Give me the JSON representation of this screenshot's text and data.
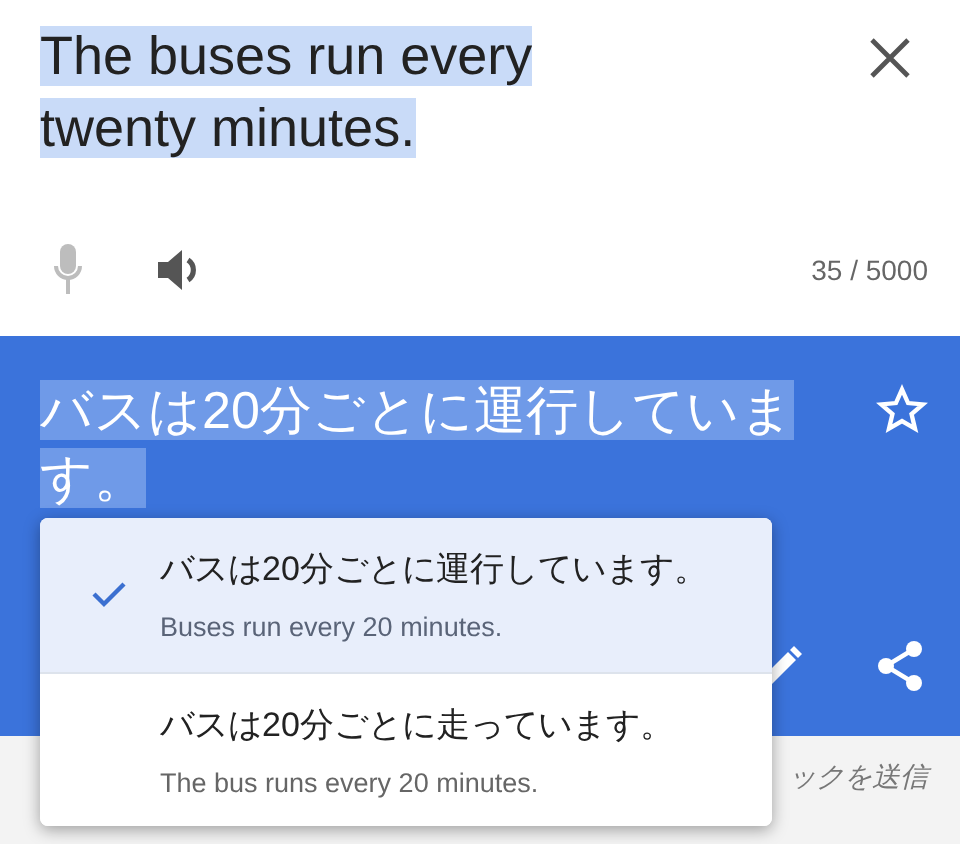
{
  "source": {
    "text": "The buses run every twenty minutes.",
    "selected": true,
    "count": "35 / 5000",
    "mic_disabled": true
  },
  "translation": {
    "text": "バスは20分ごとに運行しています。",
    "selected": true
  },
  "feedback": "ックを送信",
  "alternatives": [
    {
      "text": "バスは20分ごとに運行しています。",
      "meaning": "Buses run every 20 minutes.",
      "selected": true
    },
    {
      "text": "バスは20分ごとに走っています。",
      "meaning": "The bus runs every 20 minutes.",
      "selected": false
    }
  ]
}
